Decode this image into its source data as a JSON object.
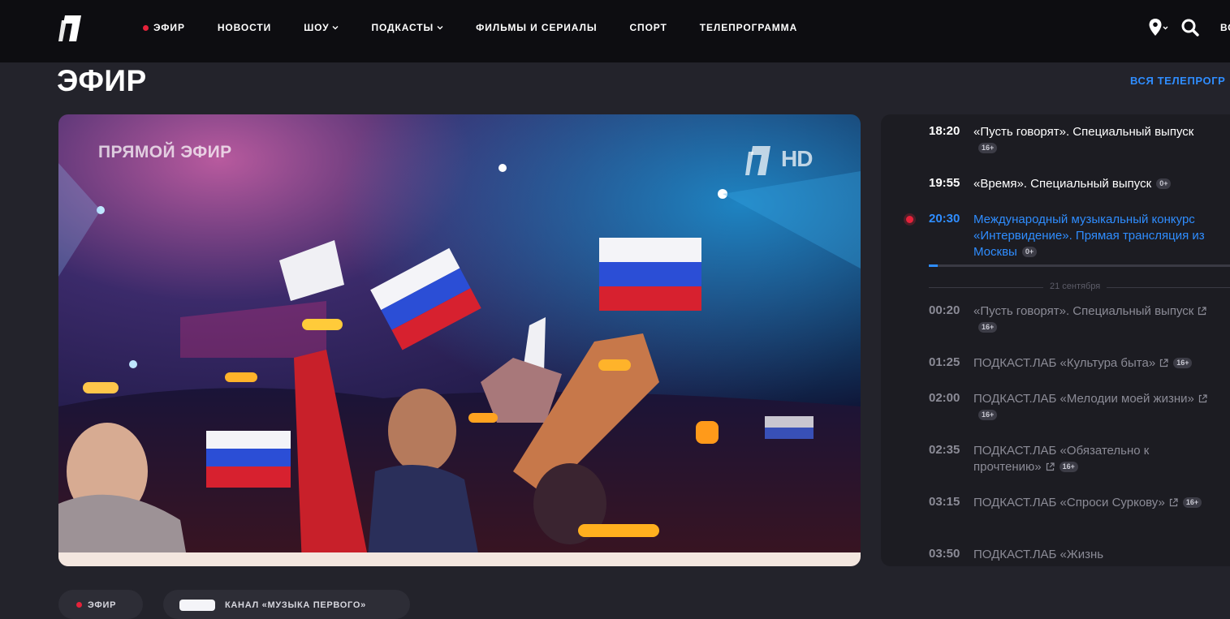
{
  "brand": {
    "logo": "channel-one-logo",
    "accent": "#2f8dff",
    "live_color": "#e5223a"
  },
  "nav": {
    "items": [
      {
        "label": "ЭФИР",
        "live": true,
        "dropdown": false
      },
      {
        "label": "НОВОСТИ",
        "dropdown": false
      },
      {
        "label": "ШОУ",
        "dropdown": true
      },
      {
        "label": "ПОДКАСТЫ",
        "dropdown": true
      },
      {
        "label": "ФИЛЬМЫ И СЕРИАЛЫ",
        "dropdown": false
      },
      {
        "label": "СПОРТ",
        "dropdown": false
      },
      {
        "label": "ТЕЛЕПРОГРАММА",
        "dropdown": false
      }
    ],
    "icons": [
      "location-icon",
      "search-icon"
    ],
    "cut_label": "ВС"
  },
  "page": {
    "title": "ЭФИР",
    "all_program_link": "ВСЯ ТЕЛЕПРОГР"
  },
  "player": {
    "live_overlay": "ПРЯМОЙ ЭФИР",
    "hd_badge": "HD"
  },
  "schedule": {
    "items": [
      {
        "time": "18:20",
        "title": "«Пусть говорят». Специальный выпуск",
        "age": "16+",
        "state": "past",
        "external": false
      },
      {
        "time": "19:55",
        "title": "«Время». Специальный выпуск",
        "age": "0+",
        "state": "past",
        "external": false
      },
      {
        "time": "20:30",
        "title": "Международный музыкальный конкурс «Интервидение». Прямая трансляция из Москвы",
        "age": "0+",
        "state": "current",
        "external": false,
        "progress": 0.03
      },
      {
        "time": "00:20",
        "title": "«Пусть говорят». Специальный выпуск",
        "age": "16+",
        "state": "future",
        "external": true
      },
      {
        "time": "01:25",
        "title": "ПОДКАСТ.ЛАБ «Культура быта»",
        "age": "16+",
        "state": "future",
        "external": true
      },
      {
        "time": "02:00",
        "title": "ПОДКАСТ.ЛАБ «Мелодии моей жизни»",
        "age": "16+",
        "state": "future",
        "external": true
      },
      {
        "time": "02:35",
        "title": "ПОДКАСТ.ЛАБ «Обязательно к прочтению»",
        "age": "16+",
        "state": "future",
        "external": true
      },
      {
        "time": "03:15",
        "title": "ПОДКАСТ.ЛАБ «Спроси Суркову»",
        "age": "16+",
        "state": "future",
        "external": true
      },
      {
        "time": "03:50",
        "title": "ПОДКАСТ.ЛАБ «Жизнь",
        "age": "",
        "state": "future",
        "external": false
      }
    ],
    "date_separator": "21 сентября"
  },
  "chips": [
    {
      "label": "ЭФИР"
    },
    {
      "label": "КАНАЛ «МУЗЫКА ПЕРВОГО»"
    }
  ]
}
